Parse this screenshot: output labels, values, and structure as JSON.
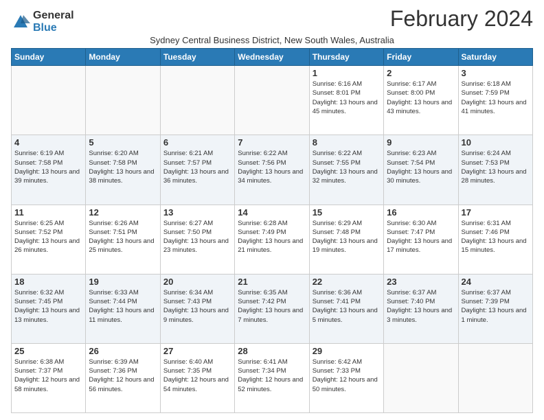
{
  "logo": {
    "general": "General",
    "blue": "Blue"
  },
  "title": "February 2024",
  "subtitle": "Sydney Central Business District, New South Wales, Australia",
  "days_header": [
    "Sunday",
    "Monday",
    "Tuesday",
    "Wednesday",
    "Thursday",
    "Friday",
    "Saturday"
  ],
  "weeks": [
    [
      {
        "day": "",
        "info": ""
      },
      {
        "day": "",
        "info": ""
      },
      {
        "day": "",
        "info": ""
      },
      {
        "day": "",
        "info": ""
      },
      {
        "day": "1",
        "info": "Sunrise: 6:16 AM\nSunset: 8:01 PM\nDaylight: 13 hours\nand 45 minutes."
      },
      {
        "day": "2",
        "info": "Sunrise: 6:17 AM\nSunset: 8:00 PM\nDaylight: 13 hours\nand 43 minutes."
      },
      {
        "day": "3",
        "info": "Sunrise: 6:18 AM\nSunset: 7:59 PM\nDaylight: 13 hours\nand 41 minutes."
      }
    ],
    [
      {
        "day": "4",
        "info": "Sunrise: 6:19 AM\nSunset: 7:58 PM\nDaylight: 13 hours\nand 39 minutes."
      },
      {
        "day": "5",
        "info": "Sunrise: 6:20 AM\nSunset: 7:58 PM\nDaylight: 13 hours\nand 38 minutes."
      },
      {
        "day": "6",
        "info": "Sunrise: 6:21 AM\nSunset: 7:57 PM\nDaylight: 13 hours\nand 36 minutes."
      },
      {
        "day": "7",
        "info": "Sunrise: 6:22 AM\nSunset: 7:56 PM\nDaylight: 13 hours\nand 34 minutes."
      },
      {
        "day": "8",
        "info": "Sunrise: 6:22 AM\nSunset: 7:55 PM\nDaylight: 13 hours\nand 32 minutes."
      },
      {
        "day": "9",
        "info": "Sunrise: 6:23 AM\nSunset: 7:54 PM\nDaylight: 13 hours\nand 30 minutes."
      },
      {
        "day": "10",
        "info": "Sunrise: 6:24 AM\nSunset: 7:53 PM\nDaylight: 13 hours\nand 28 minutes."
      }
    ],
    [
      {
        "day": "11",
        "info": "Sunrise: 6:25 AM\nSunset: 7:52 PM\nDaylight: 13 hours\nand 26 minutes."
      },
      {
        "day": "12",
        "info": "Sunrise: 6:26 AM\nSunset: 7:51 PM\nDaylight: 13 hours\nand 25 minutes."
      },
      {
        "day": "13",
        "info": "Sunrise: 6:27 AM\nSunset: 7:50 PM\nDaylight: 13 hours\nand 23 minutes."
      },
      {
        "day": "14",
        "info": "Sunrise: 6:28 AM\nSunset: 7:49 PM\nDaylight: 13 hours\nand 21 minutes."
      },
      {
        "day": "15",
        "info": "Sunrise: 6:29 AM\nSunset: 7:48 PM\nDaylight: 13 hours\nand 19 minutes."
      },
      {
        "day": "16",
        "info": "Sunrise: 6:30 AM\nSunset: 7:47 PM\nDaylight: 13 hours\nand 17 minutes."
      },
      {
        "day": "17",
        "info": "Sunrise: 6:31 AM\nSunset: 7:46 PM\nDaylight: 13 hours\nand 15 minutes."
      }
    ],
    [
      {
        "day": "18",
        "info": "Sunrise: 6:32 AM\nSunset: 7:45 PM\nDaylight: 13 hours\nand 13 minutes."
      },
      {
        "day": "19",
        "info": "Sunrise: 6:33 AM\nSunset: 7:44 PM\nDaylight: 13 hours\nand 11 minutes."
      },
      {
        "day": "20",
        "info": "Sunrise: 6:34 AM\nSunset: 7:43 PM\nDaylight: 13 hours\nand 9 minutes."
      },
      {
        "day": "21",
        "info": "Sunrise: 6:35 AM\nSunset: 7:42 PM\nDaylight: 13 hours\nand 7 minutes."
      },
      {
        "day": "22",
        "info": "Sunrise: 6:36 AM\nSunset: 7:41 PM\nDaylight: 13 hours\nand 5 minutes."
      },
      {
        "day": "23",
        "info": "Sunrise: 6:37 AM\nSunset: 7:40 PM\nDaylight: 13 hours\nand 3 minutes."
      },
      {
        "day": "24",
        "info": "Sunrise: 6:37 AM\nSunset: 7:39 PM\nDaylight: 13 hours\nand 1 minute."
      }
    ],
    [
      {
        "day": "25",
        "info": "Sunrise: 6:38 AM\nSunset: 7:37 PM\nDaylight: 12 hours\nand 58 minutes."
      },
      {
        "day": "26",
        "info": "Sunrise: 6:39 AM\nSunset: 7:36 PM\nDaylight: 12 hours\nand 56 minutes."
      },
      {
        "day": "27",
        "info": "Sunrise: 6:40 AM\nSunset: 7:35 PM\nDaylight: 12 hours\nand 54 minutes."
      },
      {
        "day": "28",
        "info": "Sunrise: 6:41 AM\nSunset: 7:34 PM\nDaylight: 12 hours\nand 52 minutes."
      },
      {
        "day": "29",
        "info": "Sunrise: 6:42 AM\nSunset: 7:33 PM\nDaylight: 12 hours\nand 50 minutes."
      },
      {
        "day": "",
        "info": ""
      },
      {
        "day": "",
        "info": ""
      }
    ]
  ],
  "accent_color": "#2a7ab5"
}
